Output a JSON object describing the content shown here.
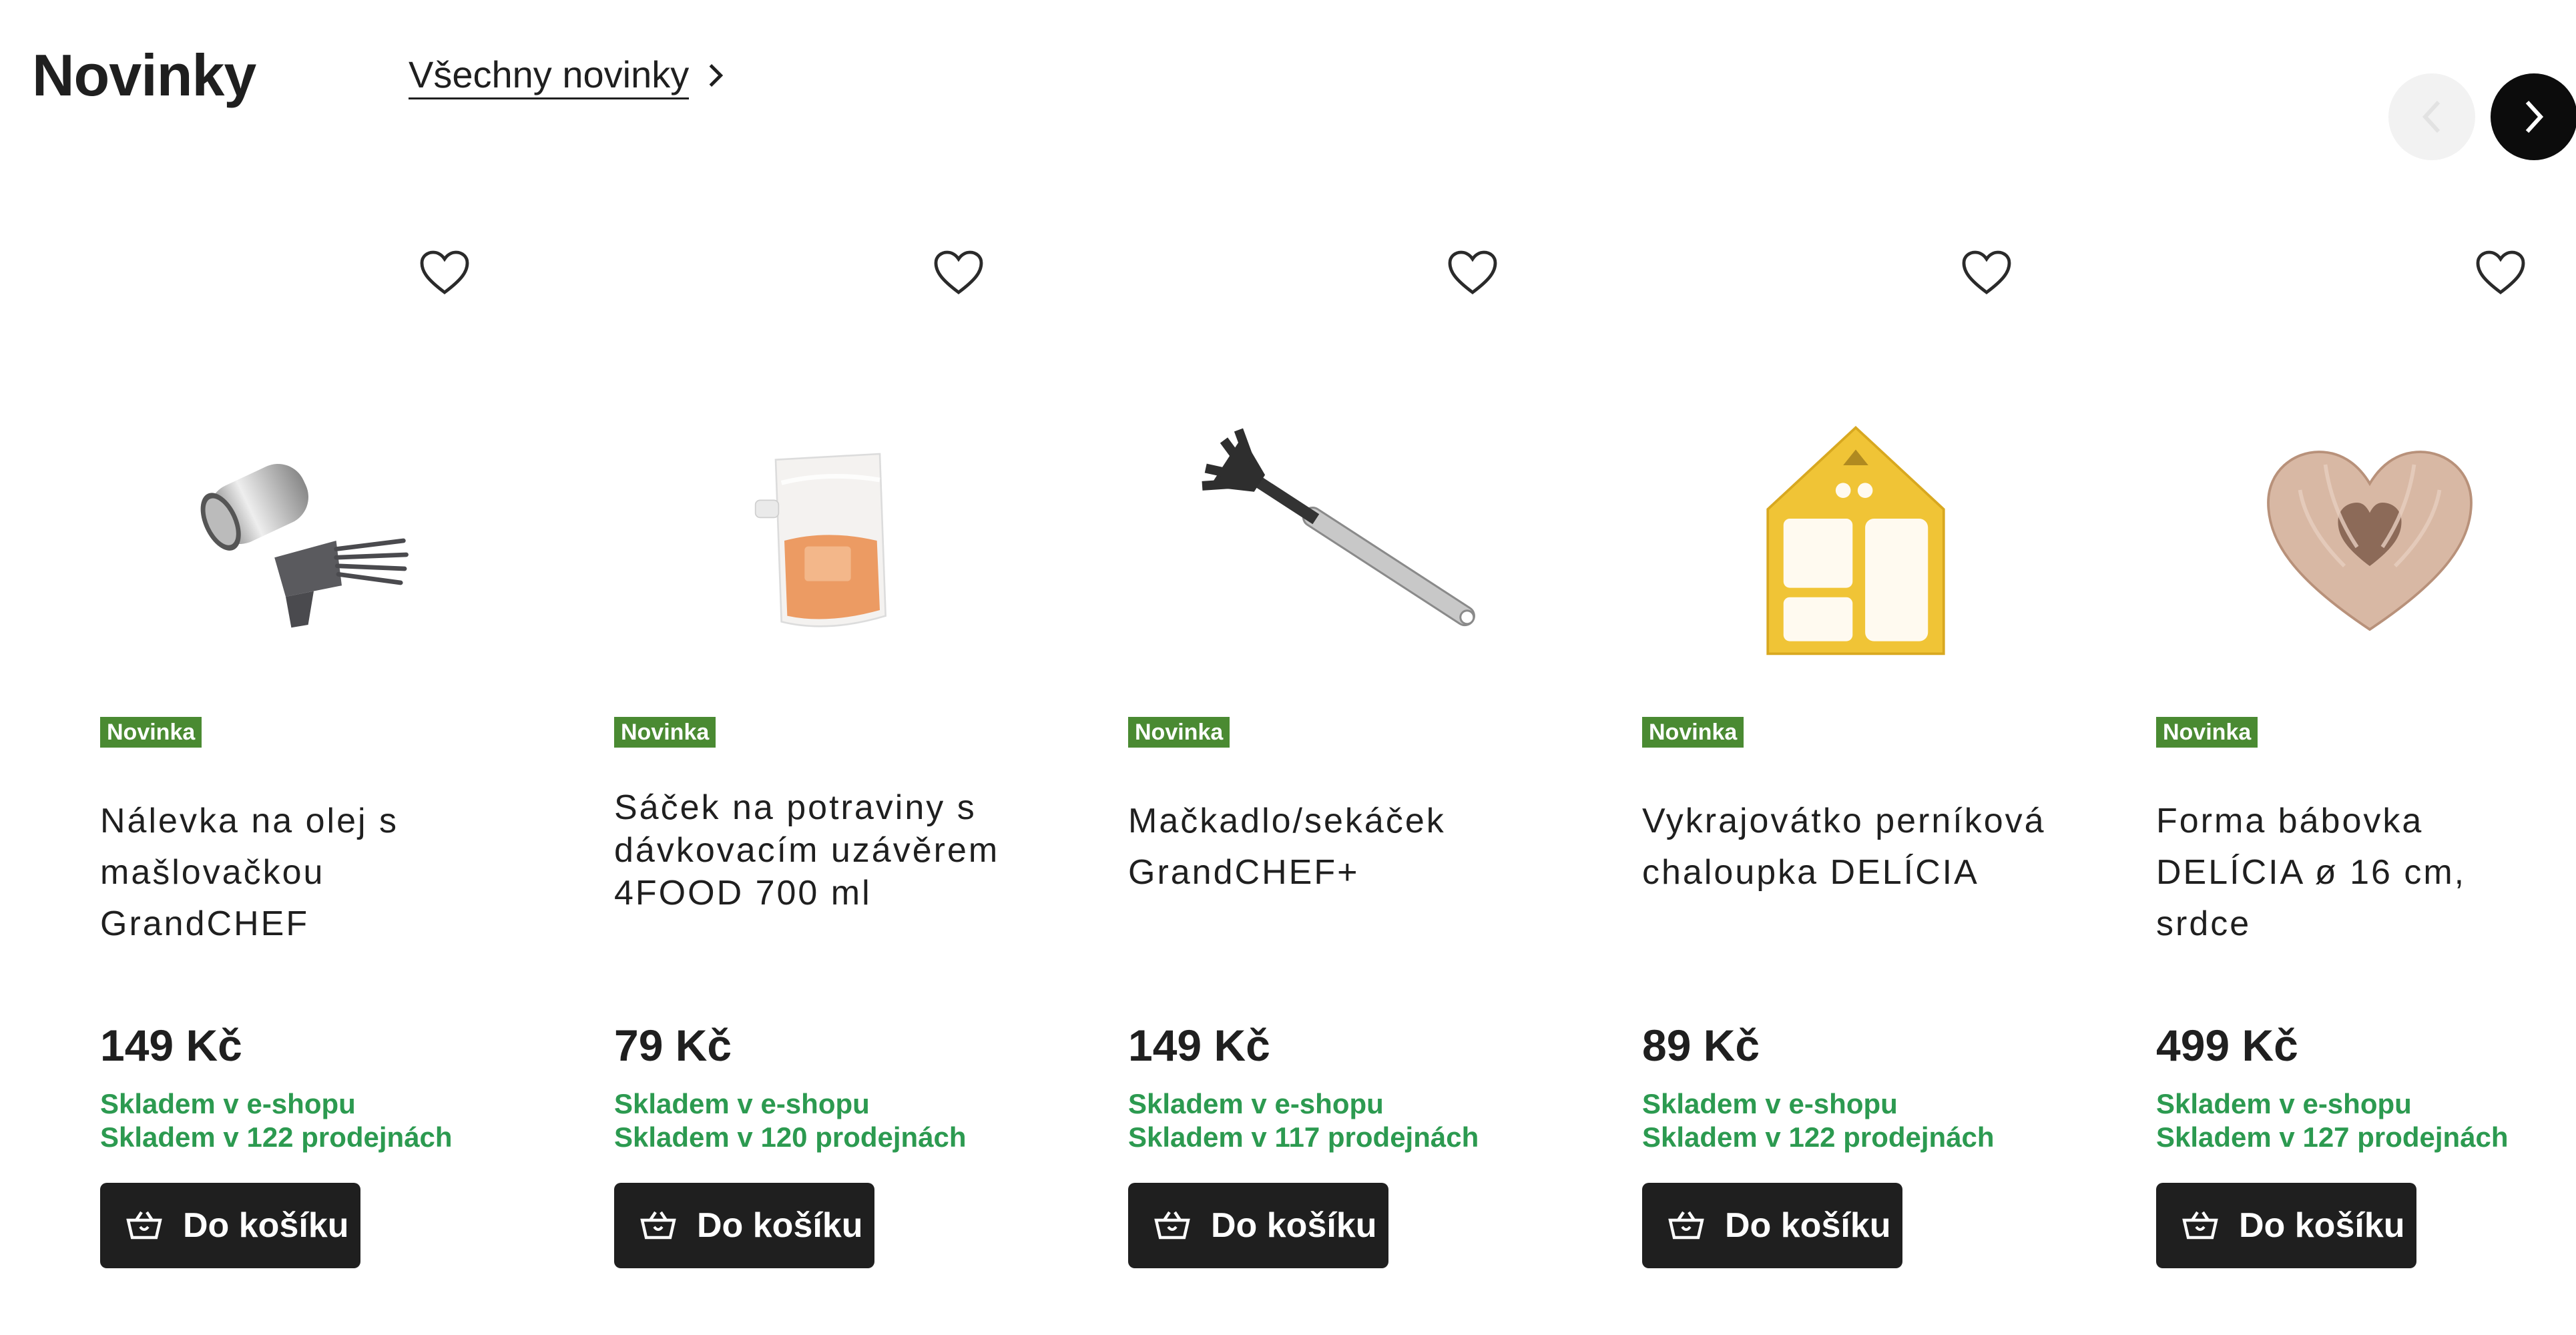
{
  "header": {
    "title": "Novinky",
    "all_link": "Všechny novinky"
  },
  "nav": {
    "prev_icon": "chevron-left-icon",
    "next_icon": "chevron-right-icon"
  },
  "products": [
    {
      "badge": "Novinka",
      "name": "Nálevka na olej s mašlovačkou GrandCHEF",
      "price": "149 Kč",
      "stock_eshop": "Skladem v e-shopu",
      "stock_stores": "Skladem v 122 prodejnách",
      "cart_label": "Do košíku"
    },
    {
      "badge": "Novinka",
      "name": "Sáček na potraviny s dávkovacím uzávěrem 4FOOD 700 ml",
      "price": "79 Kč",
      "stock_eshop": "Skladem v e-shopu",
      "stock_stores": "Skladem v 120 prodejnách",
      "cart_label": "Do košíku"
    },
    {
      "badge": "Novinka",
      "name": "Mačkadlo/sekáček GrandCHEF+",
      "price": "149 Kč",
      "stock_eshop": "Skladem v e-shopu",
      "stock_stores": "Skladem v 117 prodejnách",
      "cart_label": "Do košíku"
    },
    {
      "badge": "Novinka",
      "name": "Vykrajovátko perníková chaloupka DELÍCIA",
      "price": "89 Kč",
      "stock_eshop": "Skladem v e-shopu",
      "stock_stores": "Skladem v 122 prodejnách",
      "cart_label": "Do košíku"
    },
    {
      "badge": "Novinka",
      "name": "Forma bábovka DELÍCIA ø 16 cm, srdce",
      "price": "499 Kč",
      "stock_eshop": "Skladem v e-shopu",
      "stock_stores": "Skladem v 127 prodejnách",
      "cart_label": "Do košíku"
    }
  ],
  "colors": {
    "badge_bg": "#4a8a32",
    "stock_text": "#2c9a50",
    "button_bg": "#1f1f1f"
  }
}
